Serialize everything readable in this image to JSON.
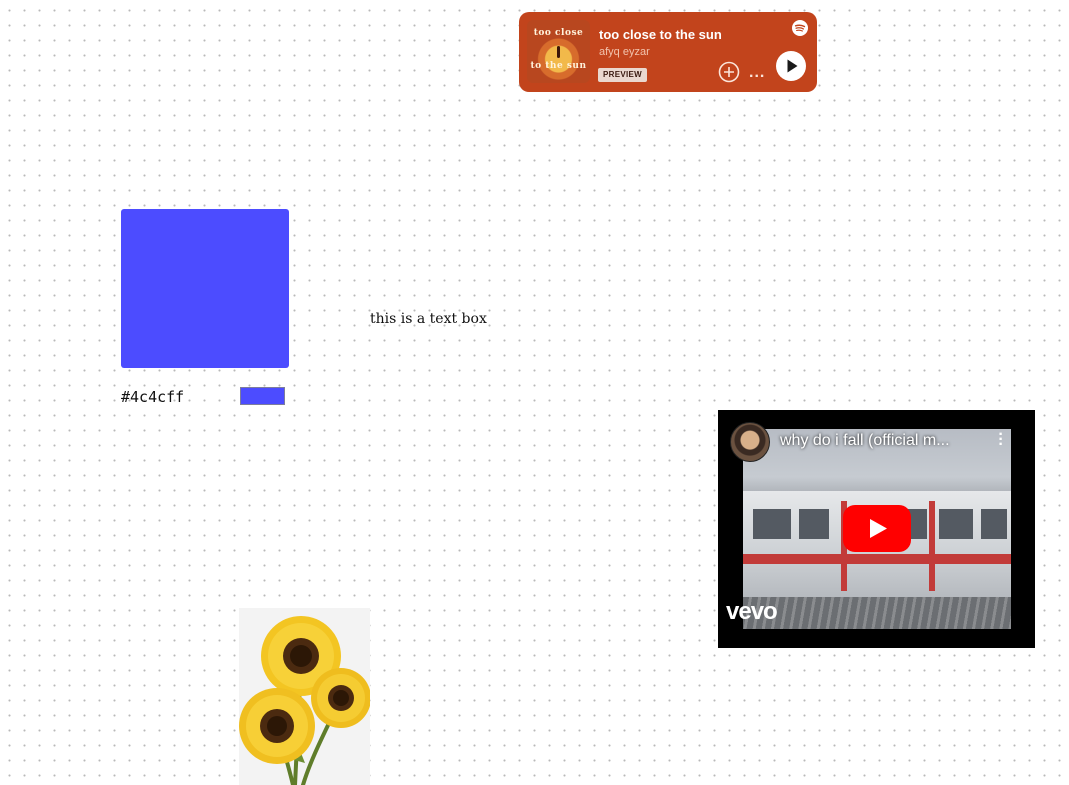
{
  "spotify": {
    "title": "too close to the sun",
    "artist": "afyq eyzar",
    "badge": "PREVIEW",
    "cover_text_top": "too close",
    "cover_text_bottom": "to the sun",
    "more": "...",
    "icons": [
      "spotify-logo-icon",
      "add-circle-icon",
      "more-icon",
      "play-icon"
    ],
    "accent": "#c2441c"
  },
  "swatch": {
    "color": "#4c4cff",
    "hex_label": "#4c4cff"
  },
  "text_box": {
    "text": "this is a text box"
  },
  "youtube": {
    "title": "why do i fall (official m...",
    "logo": "vevo",
    "icons": [
      "channel-avatar",
      "kebab-menu-icon",
      "youtube-play-icon"
    ]
  },
  "sunflowers": {
    "alt_icon": "sunflower-bouquet-image"
  }
}
